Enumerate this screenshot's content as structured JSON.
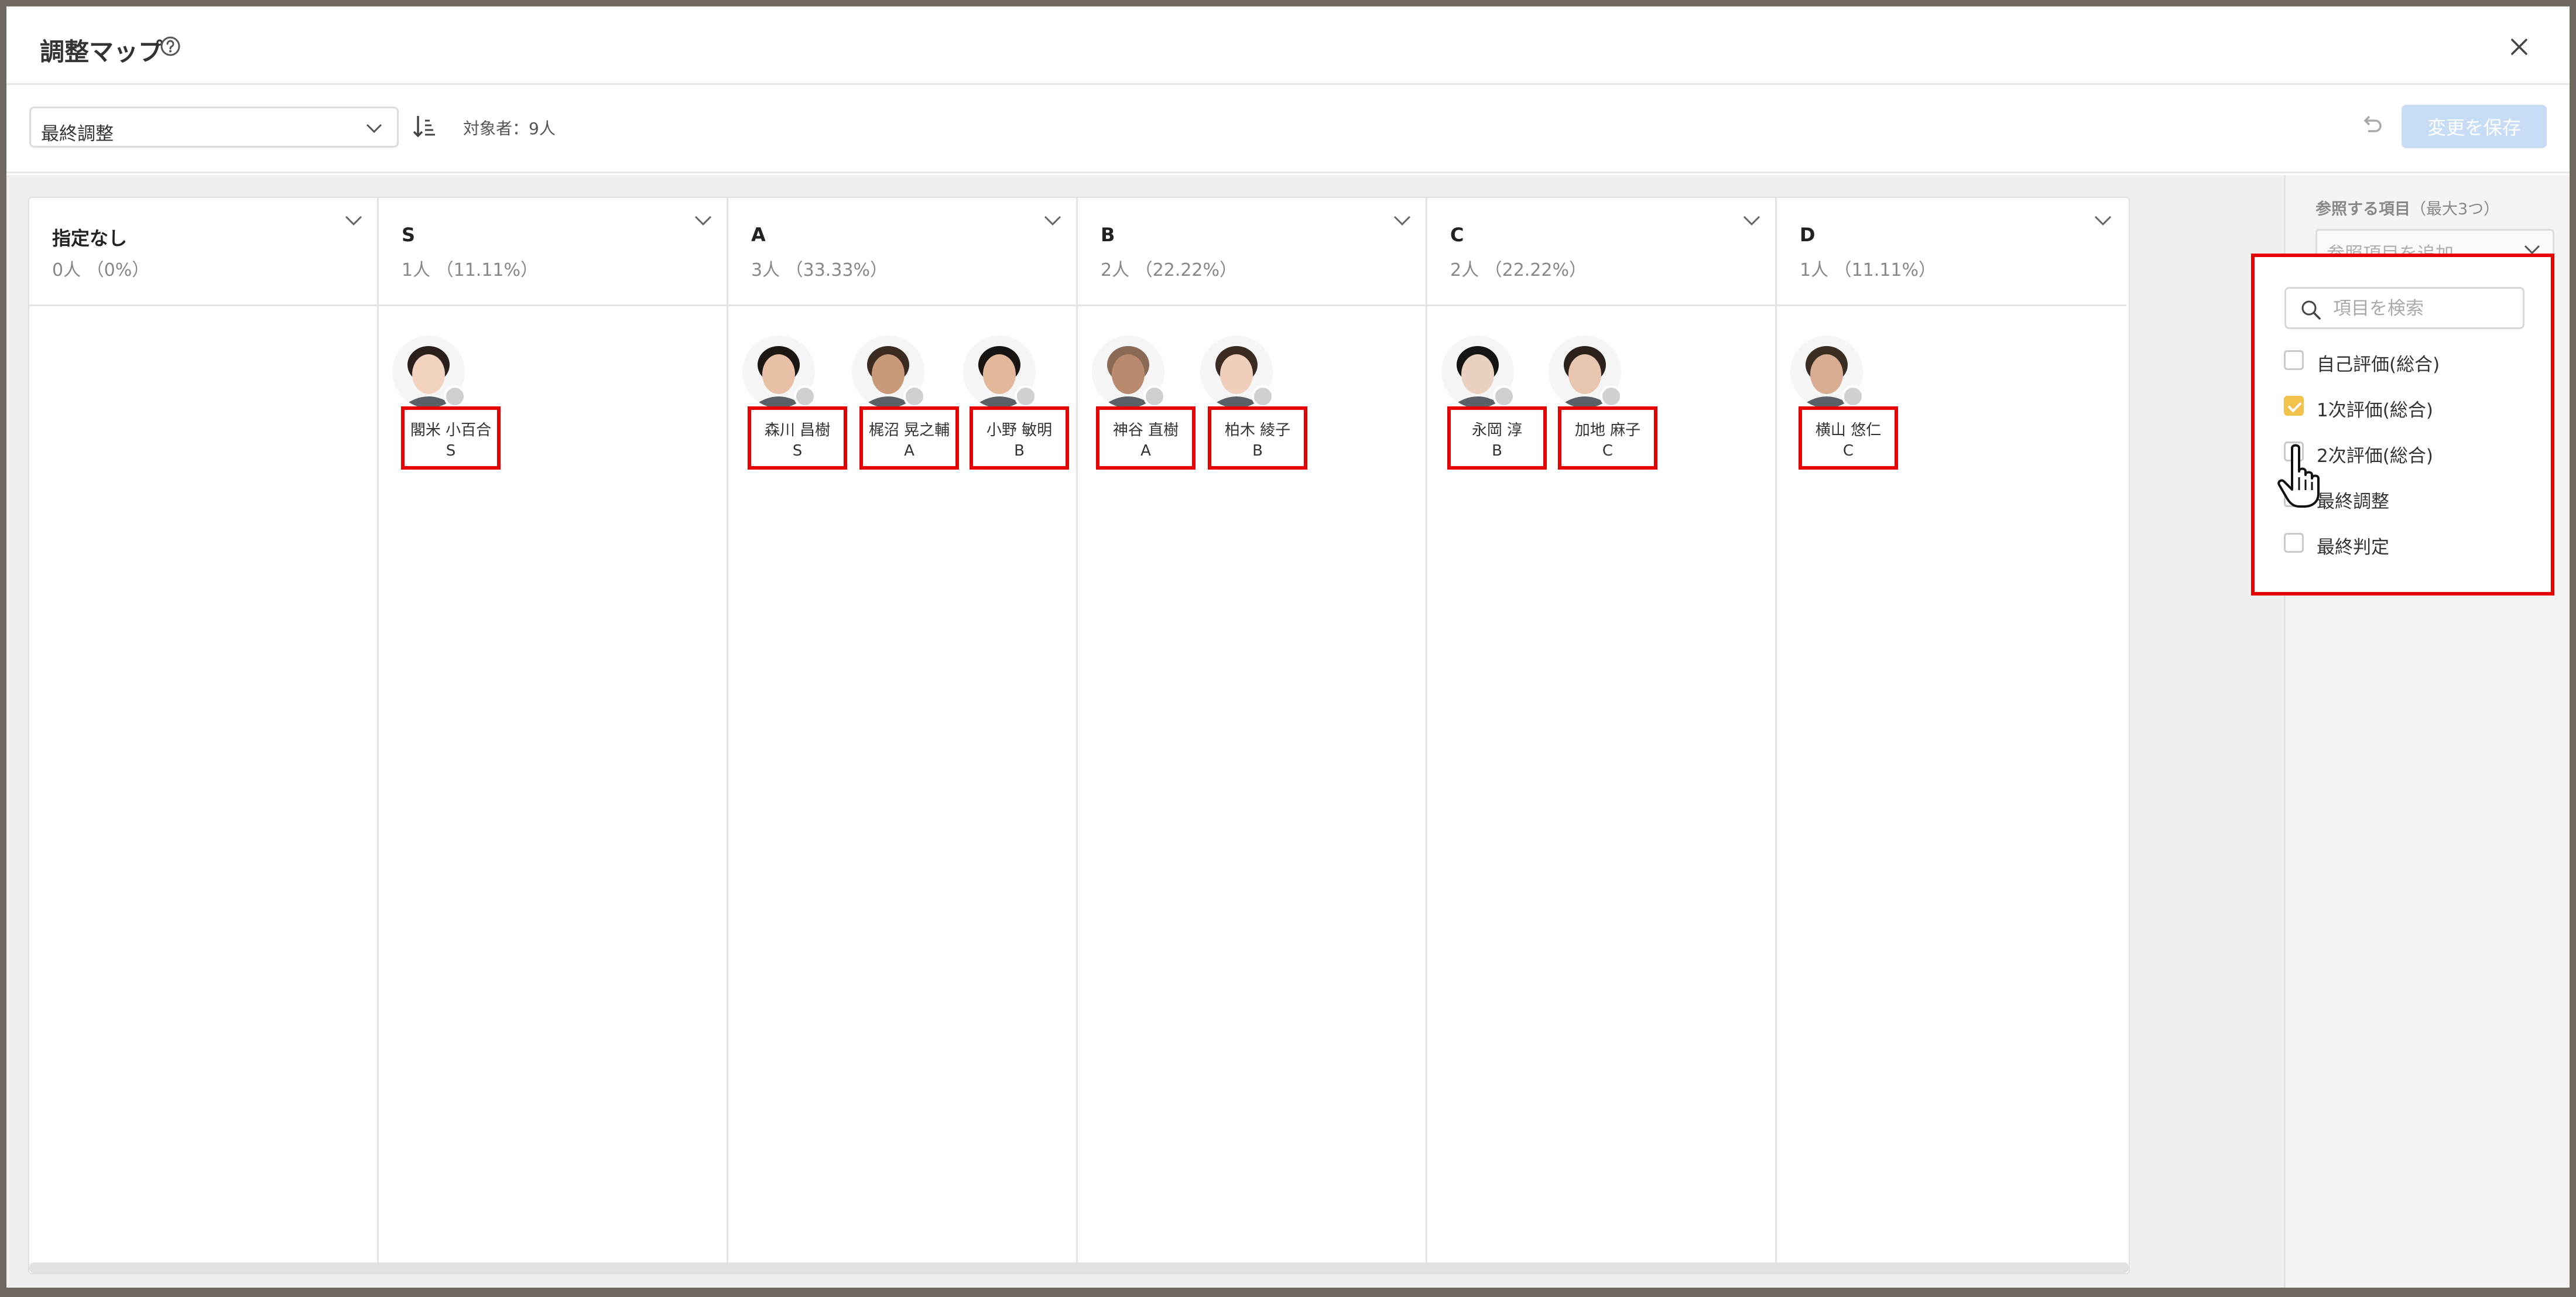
{
  "modal": {
    "title": "調整マップ"
  },
  "toolbar": {
    "select_value": "最終調整",
    "target_count": "対象者：9人",
    "save_label": "変更を保存"
  },
  "columns": [
    {
      "title": "指定なし",
      "count": "0人 （0%）"
    },
    {
      "title": "S",
      "count": "1人 （11.11%）"
    },
    {
      "title": "A",
      "count": "3人 （33.33%）"
    },
    {
      "title": "B",
      "count": "2人 （22.22%）"
    },
    {
      "title": "C",
      "count": "2人 （22.22%）"
    },
    {
      "title": "D",
      "count": "1人 （11.11%）"
    }
  ],
  "people": [
    {
      "name": "閣米 小百合",
      "grade": "S",
      "column": "S"
    },
    {
      "name": "森川 昌樹",
      "grade": "S",
      "column": "A"
    },
    {
      "name": "梶沼 晃之輔",
      "grade": "A",
      "column": "A"
    },
    {
      "name": "小野 敏明",
      "grade": "B",
      "column": "A"
    },
    {
      "name": "神谷 直樹",
      "grade": "A",
      "column": "B"
    },
    {
      "name": "柏木 綾子",
      "grade": "B",
      "column": "B"
    },
    {
      "name": "永岡 淳",
      "grade": "B",
      "column": "C"
    },
    {
      "name": "加地 麻子",
      "grade": "C",
      "column": "C"
    },
    {
      "name": "横山 悠仁",
      "grade": "C",
      "column": "D"
    }
  ],
  "side_panel": {
    "ref_label": "参照する項目",
    "ref_hint": "（最大3つ）",
    "ref_placeholder": "参照項目を追加"
  },
  "dropdown": {
    "search_placeholder": "項目を検索",
    "items": [
      {
        "label": "自己評価(総合)",
        "checked": false
      },
      {
        "label": "1次評価(総合)",
        "checked": true
      },
      {
        "label": "2次評価(総合)",
        "checked": false
      },
      {
        "label": "最終調整",
        "checked": false
      },
      {
        "label": "最終判定",
        "checked": false
      }
    ]
  },
  "colors": {
    "highlight": "#e60000",
    "save_button_disabled": "#c7dcf5",
    "checkbox_checked": "#f2c24a"
  }
}
